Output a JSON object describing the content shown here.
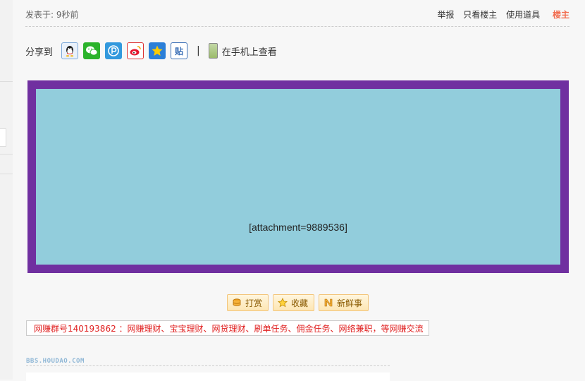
{
  "post": {
    "posted_at": "发表于: 9秒前"
  },
  "top_links": {
    "report": "举报",
    "only_owner": "只看楼主",
    "use_tool": "使用道具",
    "owner_badge": "楼主"
  },
  "share": {
    "label": "分享到",
    "icons": [
      "qq-icon",
      "wechat-icon",
      "pengyou-icon",
      "weibo-icon",
      "qzone-icon",
      "tieba-icon"
    ],
    "tieba_glyph": "贴",
    "separator": "|",
    "mobile_text": "在手机上查看"
  },
  "attachment": {
    "text": "[attachment=9889536]",
    "border_color": "#7030a0",
    "fill_color": "#92cddc"
  },
  "actions": {
    "reward": "打赏",
    "favorite": "收藏",
    "news": "新鲜事"
  },
  "ad": {
    "text": "网赚群号140193862  ：网赚理财、宝宝理财、网贷理财、刷单任务、佣金任务、网络兼职，等网赚交流"
  },
  "signature": {
    "logo_text": "BBS.HOUDAO.COM"
  },
  "colors": {
    "accent": "#f26c4f",
    "ad_red": "#e02020"
  }
}
